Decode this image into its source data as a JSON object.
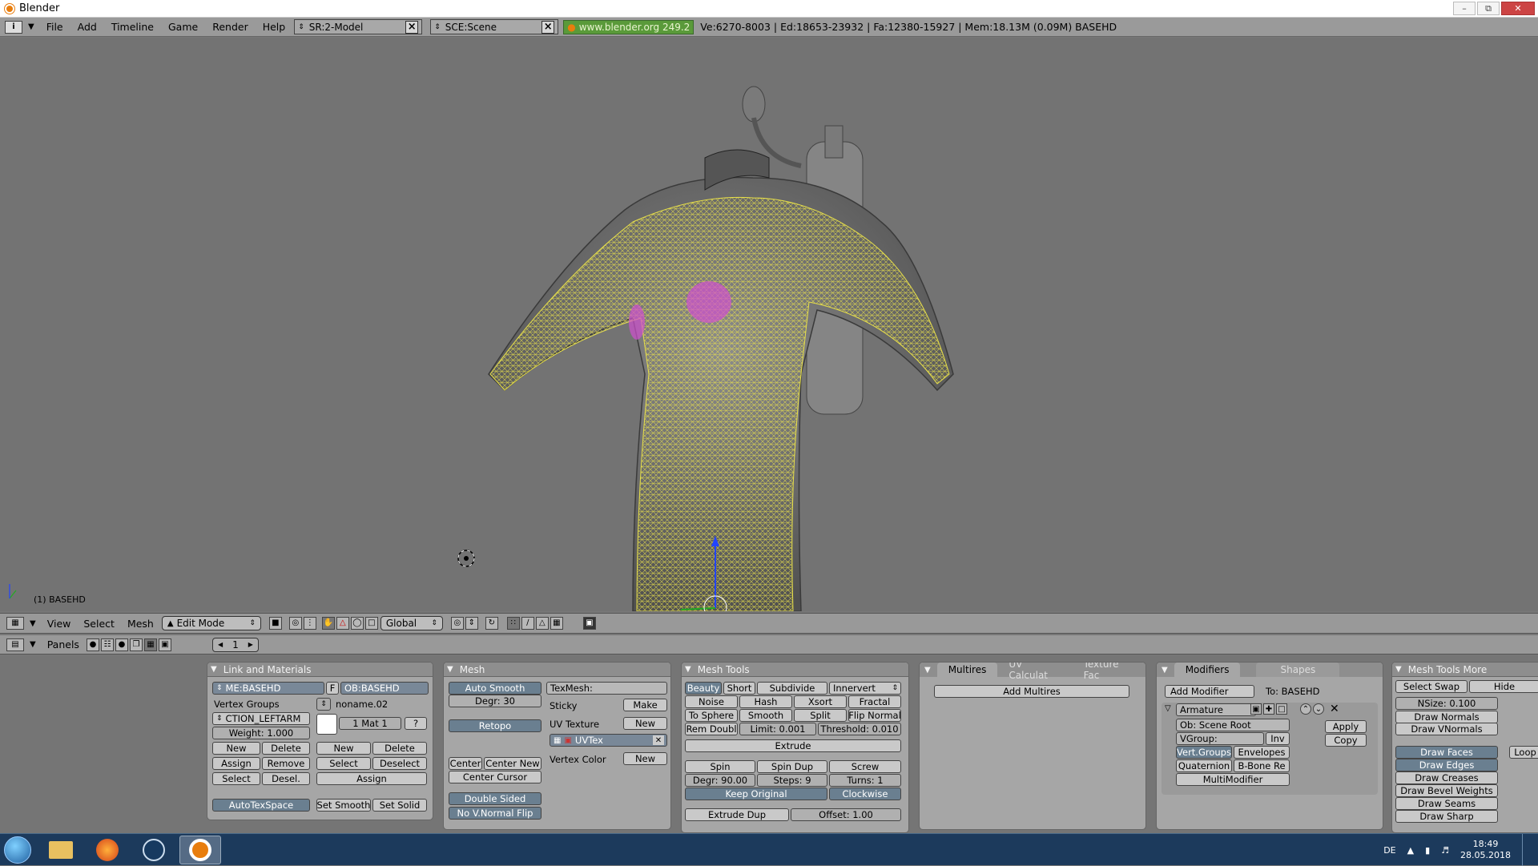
{
  "window": {
    "title": "Blender"
  },
  "topbar": {
    "menus": [
      "File",
      "Add",
      "Timeline",
      "Game",
      "Render",
      "Help"
    ],
    "screen": "SR:2-Model",
    "scene": "SCE:Scene",
    "url": "www.blender.org 249.2",
    "stats": "Ve:6270-8003 | Ed:18653-23932 | Fa:12380-15927 | Mem:18.13M (0.09M) BASEHD"
  },
  "viewport": {
    "object_label": "(1) BASEHD"
  },
  "header3d": {
    "menus": [
      "View",
      "Select",
      "Mesh"
    ],
    "mode": "Edit Mode",
    "orientation": "Global"
  },
  "buttons_header": {
    "panels_label": "Panels",
    "frame": "1"
  },
  "link_materials": {
    "title": "Link and Materials",
    "mesh_name": "ME:BASEHD",
    "f_label": "F",
    "object_name": "OB:BASEHD",
    "vertex_groups_label": "Vertex Groups",
    "material_name": "noname.02",
    "group_name": "CTION_LEFTARM",
    "mat_counter": "1 Mat 1",
    "question": "?",
    "weight": "Weight: 1.000",
    "new": "New",
    "delete": "Delete",
    "assign": "Assign",
    "remove": "Remove",
    "select": "Select",
    "desel": "Desel.",
    "deselect": "Deselect",
    "autotexspace": "AutoTexSpace",
    "set_smooth": "Set Smooth",
    "set_solid": "Set Solid"
  },
  "mesh": {
    "title": "Mesh",
    "auto_smooth": "Auto Smooth",
    "degr": "Degr: 30",
    "retopo": "Retopo",
    "center": "Center",
    "center_new": "Center New",
    "center_cursor": "Center Cursor",
    "double_sided": "Double Sided",
    "no_vnormal_flip": "No V.Normal Flip",
    "texmesh": "TexMesh:",
    "sticky": "Sticky",
    "make": "Make",
    "uv_texture": "UV Texture",
    "new": "New",
    "uvtex": "UVTex",
    "vertex_color": "Vertex Color"
  },
  "mesh_tools": {
    "title": "Mesh Tools",
    "row1": [
      "Beauty",
      "Short",
      "Subdivide",
      "Innervert"
    ],
    "row2": [
      "Noise",
      "Hash",
      "Xsort",
      "Fractal"
    ],
    "row3": [
      "To Sphere",
      "Smooth",
      "Split",
      "Flip Normal"
    ],
    "rem_doubl": "Rem Doubl",
    "limit": "Limit: 0.001",
    "threshold": "Threshold: 0.010",
    "extrude": "Extrude",
    "spin": "Spin",
    "spin_dup": "Spin Dup",
    "screw": "Screw",
    "degr": "Degr: 90.00",
    "steps": "Steps: 9",
    "turns": "Turns: 1",
    "keep_original": "Keep Original",
    "clockwise": "Clockwise",
    "extrude_dup": "Extrude Dup",
    "offset": "Offset: 1.00"
  },
  "multires": {
    "tabs": [
      "Multires",
      "UV Calculat",
      "Texture Fac"
    ],
    "add_multires": "Add Multires"
  },
  "modifiers": {
    "tabs": [
      "Modifiers",
      "Shapes"
    ],
    "add_modifier": "Add Modifier",
    "to": "To: BASEHD",
    "armature": "Armature",
    "ob": "Ob: Scene Root",
    "vgroup": "VGroup:",
    "inv": "Inv",
    "vert_groups": "Vert.Groups",
    "envelopes": "Envelopes",
    "quaternion": "Quaternion",
    "bbone": "B-Bone Re",
    "multimodifier": "MultiModifier",
    "apply": "Apply",
    "copy": "Copy"
  },
  "mesh_tools_more": {
    "title": "Mesh Tools More",
    "select_swap": "Select Swap",
    "hide": "Hide",
    "nsize": "NSize: 0.100",
    "draw_normals": "Draw Normals",
    "draw_vnormals": "Draw VNormals",
    "draw_faces": "Draw Faces",
    "draw_edges": "Draw Edges",
    "draw_creases": "Draw Creases",
    "draw_bevel": "Draw Bevel Weights",
    "draw_seams": "Draw Seams",
    "draw_sharp": "Draw Sharp",
    "loop": "Loop"
  },
  "taskbar": {
    "lang": "DE",
    "time": "18:49",
    "date": "28.05.2018"
  },
  "colors": {
    "accent_blender": "#e87d0d",
    "button_active": "#798898",
    "mesh_wire": "#e8e04a",
    "selected_face": "#e040e0"
  }
}
